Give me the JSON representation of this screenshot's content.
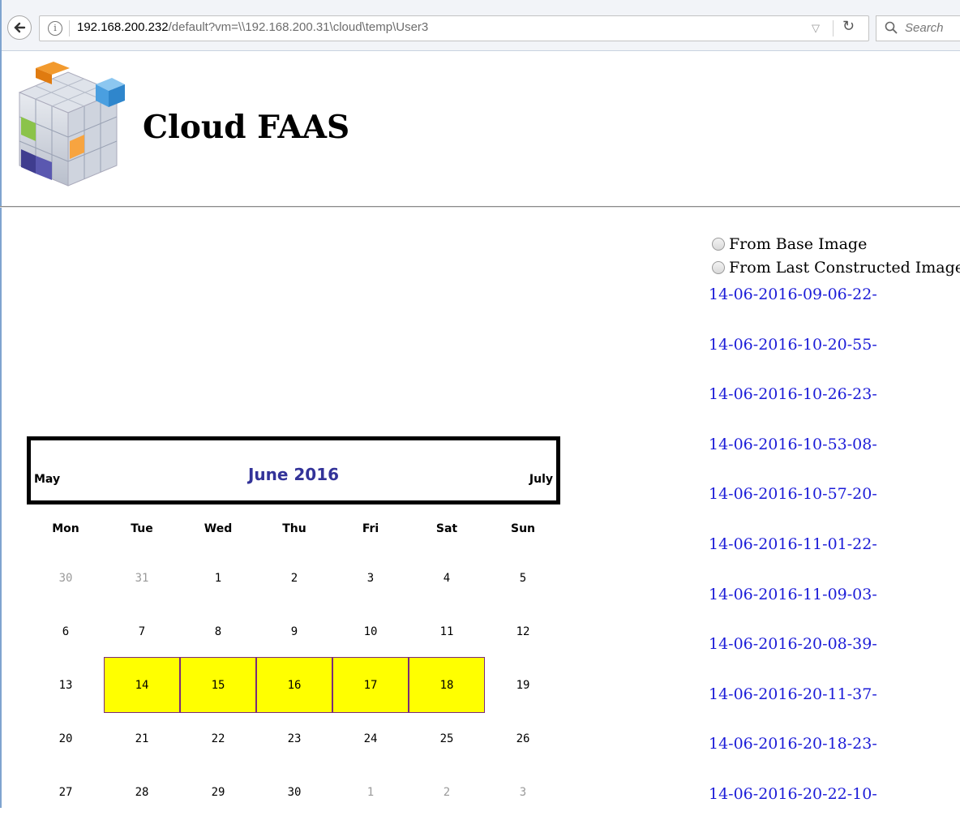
{
  "browser": {
    "url_host": "192.168.200.232",
    "url_path": "/default?vm=\\\\192.168.200.31\\cloud\\temp\\User3",
    "search_placeholder": "Search"
  },
  "header": {
    "title": "Cloud FAAS"
  },
  "options": [
    {
      "label": "From Base Image"
    },
    {
      "label": "From Last Constructed Image"
    }
  ],
  "snapshots": [
    "14-06-2016-09-06-22-",
    "14-06-2016-10-20-55-",
    "14-06-2016-10-26-23-",
    "14-06-2016-10-53-08-",
    "14-06-2016-10-57-20-",
    "14-06-2016-11-01-22-",
    "14-06-2016-11-09-03-",
    "14-06-2016-20-08-39-",
    "14-06-2016-20-11-37-",
    "14-06-2016-20-18-23-",
    "14-06-2016-20-22-10-"
  ],
  "calendar": {
    "title": "June 2016",
    "prev": "May",
    "next": "July",
    "days_of_week": [
      "Mon",
      "Tue",
      "Wed",
      "Thu",
      "Fri",
      "Sat",
      "Sun"
    ],
    "weeks": [
      [
        {
          "d": "30",
          "other": true
        },
        {
          "d": "31",
          "other": true
        },
        {
          "d": "1"
        },
        {
          "d": "2"
        },
        {
          "d": "3"
        },
        {
          "d": "4"
        },
        {
          "d": "5"
        }
      ],
      [
        {
          "d": "6"
        },
        {
          "d": "7"
        },
        {
          "d": "8"
        },
        {
          "d": "9"
        },
        {
          "d": "10"
        },
        {
          "d": "11"
        },
        {
          "d": "12"
        }
      ],
      [
        {
          "d": "13"
        },
        {
          "d": "14",
          "sel": true
        },
        {
          "d": "15",
          "sel": true
        },
        {
          "d": "16",
          "sel": true
        },
        {
          "d": "17",
          "sel": true
        },
        {
          "d": "18",
          "sel": true
        },
        {
          "d": "19"
        }
      ],
      [
        {
          "d": "20"
        },
        {
          "d": "21"
        },
        {
          "d": "22"
        },
        {
          "d": "23"
        },
        {
          "d": "24"
        },
        {
          "d": "25"
        },
        {
          "d": "26"
        }
      ],
      [
        {
          "d": "27"
        },
        {
          "d": "28"
        },
        {
          "d": "29"
        },
        {
          "d": "30"
        },
        {
          "d": "1",
          "other": true
        },
        {
          "d": "2",
          "other": true
        },
        {
          "d": "3",
          "other": true
        }
      ]
    ]
  }
}
